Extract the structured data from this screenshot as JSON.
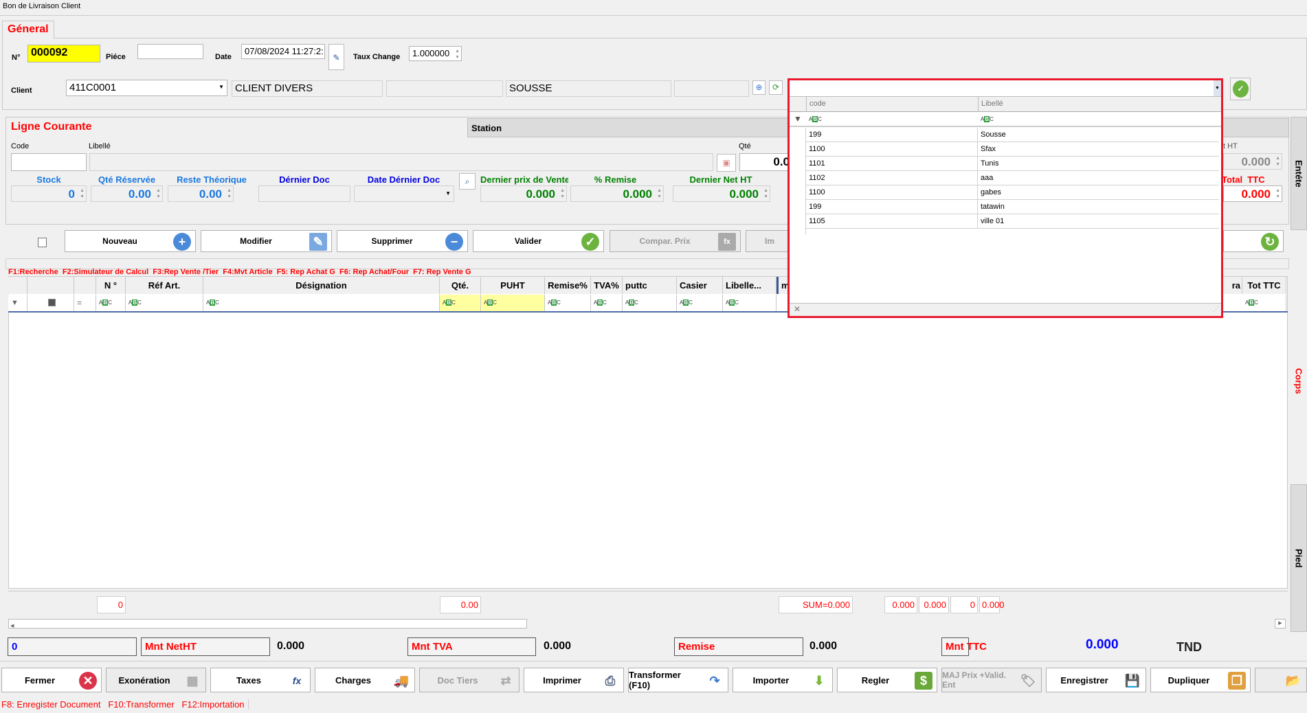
{
  "window": {
    "title": "Bon de Livraison Client"
  },
  "general": {
    "tab": "Géneral",
    "no_label": "N°",
    "no_value": "000092",
    "piece_label": "Piéce",
    "piece_value": "",
    "date_label": "Date",
    "date_value": "07/08/2024 11:27:2:",
    "taux_label": "Taux Change",
    "taux_value": "1.000000",
    "client_label": "Client",
    "client_code": "411C0001",
    "client_name": "CLIENT DIVERS",
    "client_field3": "",
    "client_city": "SOUSSE",
    "client_field5": ""
  },
  "station_popup": {
    "value": "",
    "columns": [
      "code",
      "Libellé"
    ],
    "rows": [
      [
        "199",
        "Sousse"
      ],
      [
        "1100",
        "Sfax"
      ],
      [
        "1101",
        "Tunis"
      ],
      [
        "1102",
        "aaa"
      ],
      [
        "1100",
        "gabes"
      ],
      [
        "199",
        "tatawin"
      ],
      [
        "1105",
        "ville 01"
      ]
    ]
  },
  "ligne": {
    "title": "Ligne Courante",
    "station_tab": "Station",
    "code_label": "Code",
    "libelle_label": "Libellé",
    "qte_label": "Qté",
    "qte_value": "0.0",
    "stock_label": "Stock",
    "stock": "0",
    "qte_res_label": "Qté Réservée",
    "qte_res": "0.00",
    "reste_label": "Reste Théorique",
    "reste": "0.00",
    "dernier_doc_label": "Dérnier Doc",
    "date_dernier_label": "Date Dérnier Doc",
    "dernier_prix_label": "Dernier prix de Vente",
    "dernier_prix": "0.000",
    "remise_label": "% Remise",
    "remise": "0.000",
    "net_ht_label": "Dernier Net HT",
    "net_ht": "0.000",
    "tht_label": "t HT",
    "tht": "0.000",
    "total_ttc_label": "Total  TTC",
    "total_ttc": "0.000"
  },
  "actions": {
    "nouveau": "Nouveau",
    "modifier": "Modifier",
    "supprimer": "Supprimer",
    "valider": "Valider",
    "compar": "Compar. Prix",
    "im": "Im"
  },
  "shortcuts": [
    "F1:Recherche",
    "F2:Simulateur de Calcul",
    "F3:Rep Vente /Tier",
    "F4:Mvt Article",
    "F5: Rep Achat G",
    "F6: Rep Achat/Four",
    "F7: Rep Vente G"
  ],
  "grid": {
    "columns": [
      "N °",
      "Réf Art.",
      "Désignation",
      "Qté.",
      "PUHT",
      "Remise%",
      "TVA%",
      "puttc",
      "Casier",
      "Libelle...",
      "m",
      "ra",
      "Tot TTC"
    ],
    "footer": {
      "count": "0",
      "qte": "0.00",
      "sum": "SUM=0.000",
      "t1": "0.000",
      "t2": "0.000",
      "t3": "0",
      "t4": "0.000"
    }
  },
  "totals": {
    "count": "0",
    "net_ht_label": "Mnt NetHT",
    "net_ht": "0.000",
    "tva_label": "Mnt TVA",
    "tva": "0.000",
    "remise_label": "Remise",
    "remise": "0.000",
    "ttc_label": "Mnt TTC",
    "ttc": "0.000",
    "currency": "TND"
  },
  "side_tabs": {
    "entete": "Entéte",
    "corps": "Corps",
    "pied": "Pied"
  },
  "bottom": {
    "fermer": "Fermer",
    "exoneration": "Exonération",
    "taxes": "Taxes",
    "charges": "Charges",
    "doc_tiers": "Doc Tiers",
    "imprimer": "Imprimer",
    "transformer": "Transformer (F10)",
    "importer": "Importer",
    "regler": "Regler",
    "maj": "MAJ Prix +Valid. Ent",
    "enregistrer": "Enregistrer",
    "dupliquer": "Dupliquer"
  },
  "status": "F8: Enregister Document   F10:Transformer   F12:Importation",
  "colors": {
    "accent": "#ff0000",
    "highlight": "#ffff00",
    "popup_border": "#e8192c"
  }
}
